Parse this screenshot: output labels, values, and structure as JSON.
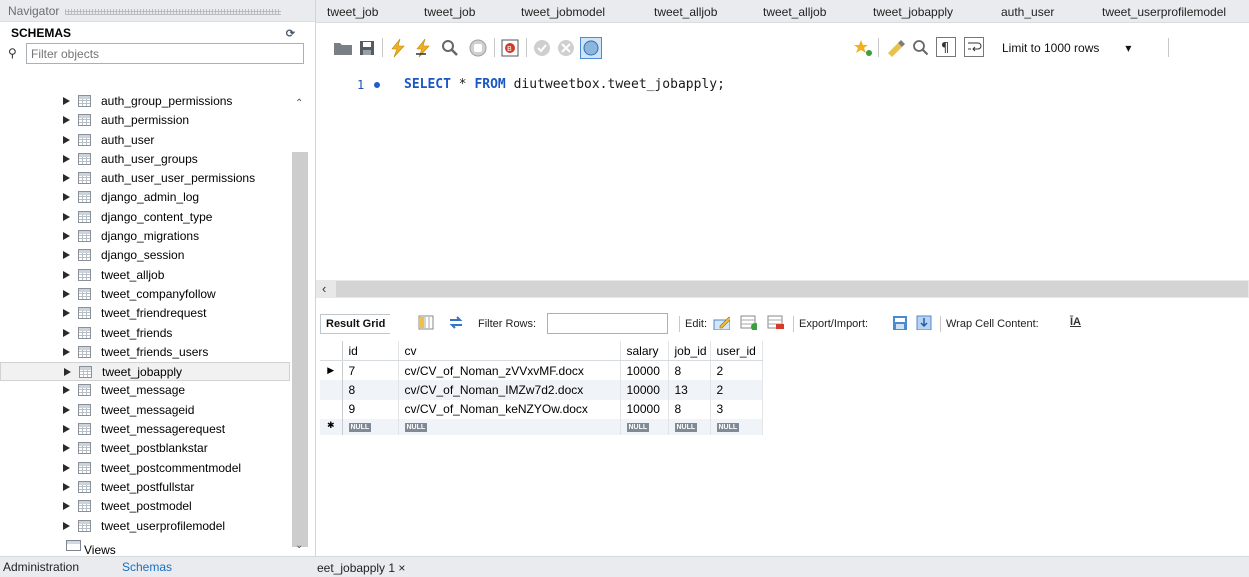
{
  "navigator": {
    "title": "Navigator",
    "schemas_label": "SCHEMAS",
    "filter_placeholder": "Filter objects",
    "tables": [
      "auth_group_permissions",
      "auth_permission",
      "auth_user",
      "auth_user_groups",
      "auth_user_user_permissions",
      "django_admin_log",
      "django_content_type",
      "django_migrations",
      "django_session",
      "tweet_alljob",
      "tweet_companyfollow",
      "tweet_friendrequest",
      "tweet_friends",
      "tweet_friends_users",
      "tweet_jobapply",
      "tweet_message",
      "tweet_messageid",
      "tweet_messagerequest",
      "tweet_postblankstar",
      "tweet_postcommentmodel",
      "tweet_postfullstar",
      "tweet_postmodel",
      "tweet_userprofilemodel"
    ],
    "selected_table": "tweet_jobapply",
    "views_label": "Views",
    "bottom_tabs": [
      "Administration",
      "Schemas"
    ]
  },
  "query_tabs": [
    "tweet_job",
    "tweet_job",
    "tweet_jobmodel",
    "tweet_alljob",
    "tweet_alljob",
    "tweet_jobapply",
    "auth_user",
    "tweet_userprofilemodel"
  ],
  "toolbar": {
    "limit_label": "Limit to 1000 rows",
    "icons": [
      "open-folder-icon",
      "save-icon",
      "execute-icon",
      "execute-current-icon",
      "explain-icon",
      "stop-icon",
      "toggle-error-icon",
      "commit-icon",
      "rollback-icon",
      "autocommit-icon",
      "beautify-icon",
      "find-icon",
      "invisible-chars-icon",
      "wrap-icon"
    ]
  },
  "editor": {
    "line_number": "1",
    "keyword_select": "SELECT",
    "star": " * ",
    "keyword_from": "FROM",
    "target": " diutweetbox.tweet_jobapply;"
  },
  "result_bar": {
    "result_grid_label": "Result Grid",
    "filter_rows_label": "Filter Rows:",
    "edit_label": "Edit:",
    "export_label": "Export/Import:",
    "wrap_label": "Wrap Cell Content:"
  },
  "grid": {
    "columns": [
      "id",
      "cv",
      "salary",
      "job_id",
      "user_id"
    ],
    "rows": [
      [
        "7",
        "cv/CV_of_Noman_zVVxvMF.docx",
        "10000",
        "8",
        "2"
      ],
      [
        "8",
        "cv/CV_of_Noman_IMZw7d2.docx",
        "10000",
        "13",
        "2"
      ],
      [
        "9",
        "cv/CV_of_Noman_keNZYOw.docx",
        "10000",
        "8",
        "3"
      ]
    ],
    "null_label": "NULL"
  },
  "bottom_tab": {
    "label": "eet_jobapply 1",
    "close": "×"
  }
}
